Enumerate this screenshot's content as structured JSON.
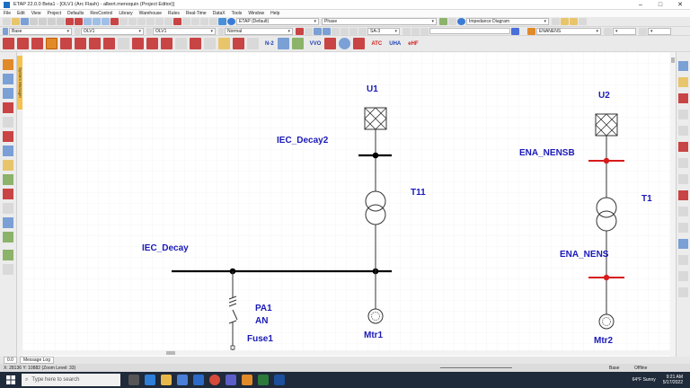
{
  "window": {
    "title": "ETAP 22.0.0 Beta1 - [OLV1 (Arc Flash) - albert.menoquin (Project Editor)]"
  },
  "menu": [
    "File",
    "Edit",
    "View",
    "Project",
    "Defaults",
    "RevControl",
    "Library",
    "Warehouse",
    "Rules",
    "Real-Time",
    "DataX",
    "Tools",
    "Window",
    "Help"
  ],
  "toolbar": {
    "config": "ETAP (Default)",
    "phase": "Phase",
    "diagram": "Impedance Diagram",
    "base": "Base",
    "olv1a": "OLV1",
    "olv1b": "OLV1",
    "mode": "Normal",
    "study": "SA-3",
    "study_case": "ENANENS",
    "n2": "N-2",
    "vvo": "VVO",
    "atc": "ATC",
    "uha": "UHA",
    "ehf": "eHF"
  },
  "sidebar": {
    "tab": "System Manager"
  },
  "diagram": {
    "labels": {
      "u1": "U1",
      "u2": "U2",
      "iec_decay2": "IEC_Decay2",
      "iec_decay": "IEC_Decay",
      "t11": "T11",
      "t1": "T1",
      "ena_nensb": "ENA_NENSB",
      "ena_nens": "ENA_NENS",
      "pa1": "PA1",
      "an": "AN",
      "fuse1": "Fuse1",
      "mtr1": "Mtr1",
      "mtr2": "Mtr2"
    },
    "colors": {
      "label": "#1a1ab8",
      "line": "#222222",
      "red": "#d81b1b"
    }
  },
  "message_tabs": [
    "0.0",
    "Message Log"
  ],
  "status": {
    "left": "X: 28136   Y: 10882 (Zoom Level: 33)",
    "base": "Base",
    "mode": "Offline"
  },
  "taskbar": {
    "search_placeholder": "Type here to search",
    "weather": "64°F  Sunny",
    "time": "9:21 AM",
    "date": "5/17/2022"
  }
}
